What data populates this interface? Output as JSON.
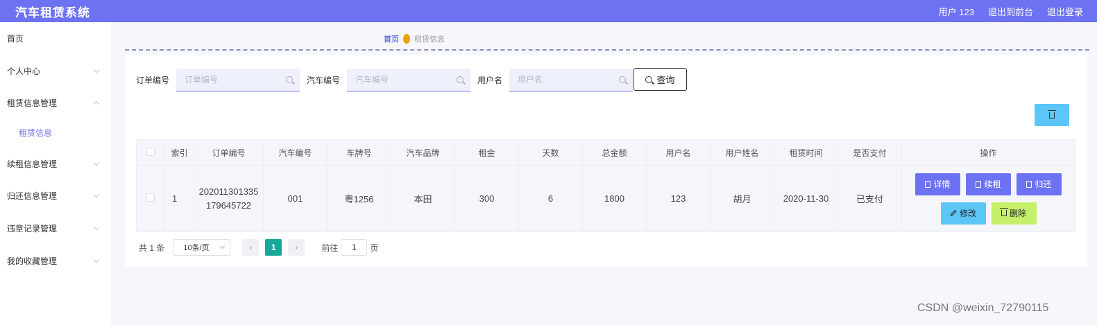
{
  "topbar": {
    "brand": "汽车租赁系统",
    "user": "用户 123",
    "to_front": "退出到前台",
    "logout": "退出登录"
  },
  "sidebar": {
    "items": [
      {
        "label": "首页"
      },
      {
        "label": "个人中心"
      },
      {
        "label": "租赁信息管理"
      },
      {
        "label": "租赁信息"
      },
      {
        "label": "续租信息管理"
      },
      {
        "label": "归还信息管理"
      },
      {
        "label": "违章记录管理"
      },
      {
        "label": "我的收藏管理"
      }
    ]
  },
  "breadcrumb": {
    "home": "首页",
    "current": "租赁信息"
  },
  "search": {
    "order_label": "订单编号",
    "order_placeholder": "订单编号",
    "car_label": "汽车编号",
    "car_placeholder": "汽车编号",
    "user_label": "用户名",
    "user_placeholder": "用户名",
    "query_label": "查询"
  },
  "table": {
    "headers": [
      "索引",
      "订单编号",
      "汽车编号",
      "车牌号",
      "汽车品牌",
      "租金",
      "天数",
      "总金额",
      "用户名",
      "用户姓名",
      "租赁时间",
      "是否支付",
      "操作"
    ],
    "rows": [
      {
        "index": "1",
        "order_line1": "202011301335",
        "order_line2": "179645722",
        "car_no": "001",
        "plate": "粤1256",
        "brand": "本田",
        "rent": "300",
        "days": "6",
        "total": "1800",
        "username": "123",
        "name": "胡月",
        "date": "2020-11-30",
        "paid": "已支付"
      }
    ],
    "actions": {
      "detail": "详情",
      "renew": "续租",
      "return": "归还",
      "edit": "修改",
      "delete": "删除"
    }
  },
  "pager": {
    "total": "共 1 条",
    "page_size": "10条/页",
    "current": "1",
    "goto_label": "前往",
    "goto_value": "1",
    "page_suffix": "页"
  },
  "watermark": "CSDN @weixin_72790115",
  "colors": {
    "accent": "#6d72f2",
    "info": "#5cc6f7",
    "lime": "#c6f06a",
    "teal": "#14a99a"
  }
}
